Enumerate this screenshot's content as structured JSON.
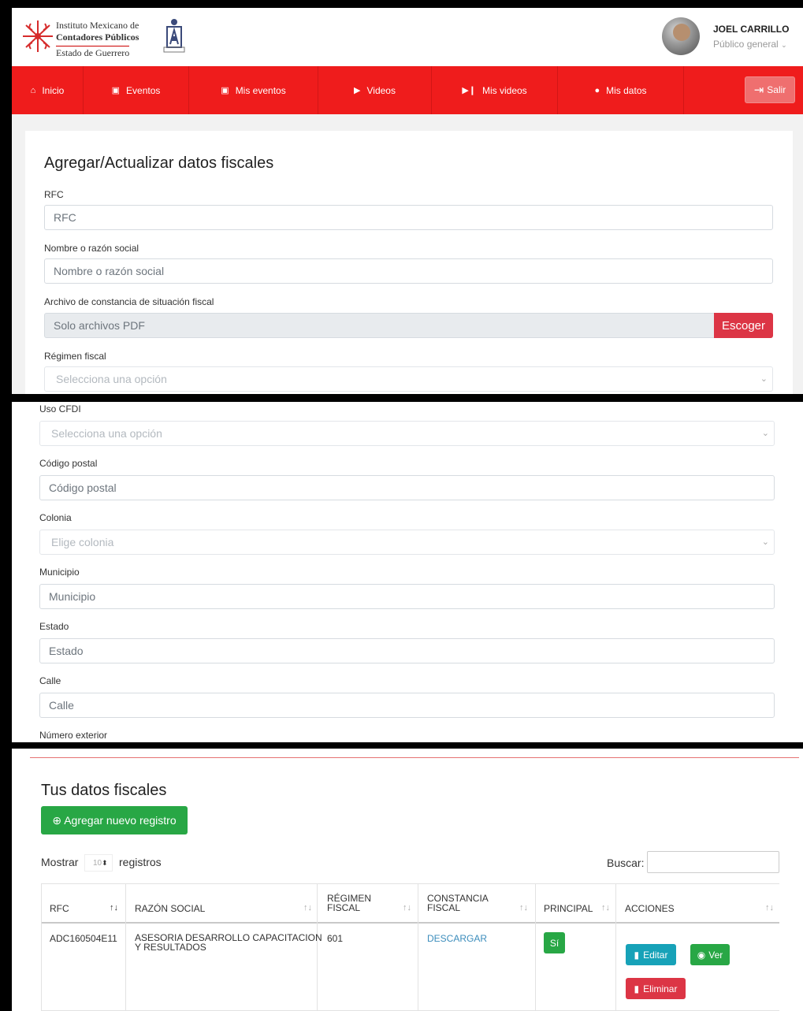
{
  "header": {
    "org_line1": "Instituto Mexicano de",
    "org_line2": "Contadores Públicos",
    "org_line3": "Estado de Guerrero",
    "user_name": "JOEL CARRILLO",
    "user_role": "Público general",
    "logout_label": "Salir"
  },
  "nav": {
    "items": [
      {
        "label": "Inicio",
        "icon": "home-icon"
      },
      {
        "label": "Eventos",
        "icon": "calendar-icon"
      },
      {
        "label": "Mis eventos",
        "icon": "calendar-check-icon"
      },
      {
        "label": "Videos",
        "icon": "play-icon"
      },
      {
        "label": "Mis videos",
        "icon": "play-pause-icon"
      },
      {
        "label": "Mis datos",
        "icon": "user-circle-icon"
      }
    ]
  },
  "form": {
    "title": "Agregar/Actualizar datos fiscales",
    "rfc_label": "RFC",
    "rfc_placeholder": "RFC",
    "razon_label": "Nombre o razón social",
    "razon_placeholder": "Nombre o razón social",
    "archivo_label": "Archivo de constancia de situación fiscal",
    "archivo_placeholder": "Solo archivos PDF",
    "archivo_button": "Escoger",
    "regimen_label": "Régimen fiscal",
    "regimen_placeholder": "Selecciona una opción",
    "uso_label": "Uso CFDI",
    "uso_placeholder": "Selecciona una opción",
    "cp_label": "Código postal",
    "cp_placeholder": "Código postal",
    "colonia_label": "Colonia",
    "colonia_placeholder": "Elige colonia",
    "municipio_label": "Municipio",
    "municipio_placeholder": "Municipio",
    "estado_label": "Estado",
    "estado_placeholder": "Estado",
    "calle_label": "Calle",
    "calle_placeholder": "Calle",
    "numext_label": "Número exterior"
  },
  "table": {
    "title": "Tus datos fiscales",
    "add_button": "⊕ Agregar nuevo registro",
    "show_label": "Mostrar",
    "length_value": "10",
    "records_label": "registros",
    "search_label": "Buscar:",
    "headers": {
      "rfc": "RFC",
      "razon": "RAZÓN SOCIAL",
      "regimen_1": "RÉGIMEN",
      "regimen_2": "FISCAL",
      "constancia_1": "CONSTANCIA",
      "constancia_2": "FISCAL",
      "principal": "PRINCIPAL",
      "acciones": "ACCIONES"
    },
    "rows": [
      {
        "rfc": "ADC160504E11",
        "razon_1": "ASESORIA DESARROLLO CAPACITACION",
        "razon_2": "Y RESULTADOS",
        "regimen": "601",
        "constancia": "DESCARGAR",
        "principal": "Sí",
        "edit": "Editar",
        "view": "Ver",
        "delete": "Eliminar"
      }
    ]
  },
  "colors": {
    "nav_red": "#ef1c1c",
    "danger": "#dc3545",
    "success": "#28a745",
    "info": "#17a2b8",
    "link": "#3c8dbc"
  }
}
